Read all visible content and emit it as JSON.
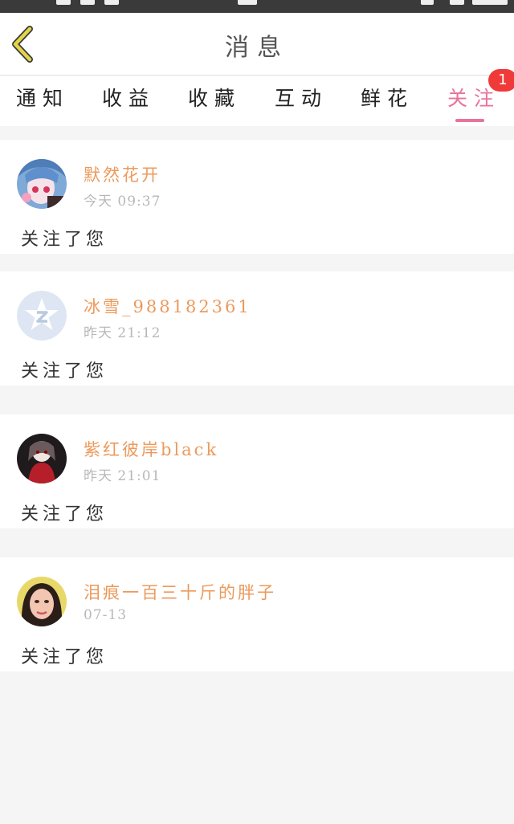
{
  "header": {
    "title": "消息",
    "back_icon": "chevron-left-icon",
    "back_color": "#e2d547"
  },
  "tabs": [
    {
      "label": "通知"
    },
    {
      "label": "收益"
    },
    {
      "label": "收藏"
    },
    {
      "label": "互动"
    },
    {
      "label": "鲜花"
    },
    {
      "label": "关注",
      "active": true,
      "badge": "1"
    }
  ],
  "accent_color": "#e8739a",
  "username_color": "#ec9a5c",
  "notifications": [
    {
      "username": "默然花开",
      "time": "今天 09:37",
      "message": "关注了您"
    },
    {
      "username": "冰雪_988182361",
      "time": "昨天 21:12",
      "message": "关注了您"
    },
    {
      "username": "紫红彼岸black",
      "time": "昨天 21:01",
      "message": "关注了您"
    },
    {
      "username": "泪痕一百三十斤的胖子",
      "time": "07-13",
      "message": "关注了您"
    }
  ]
}
